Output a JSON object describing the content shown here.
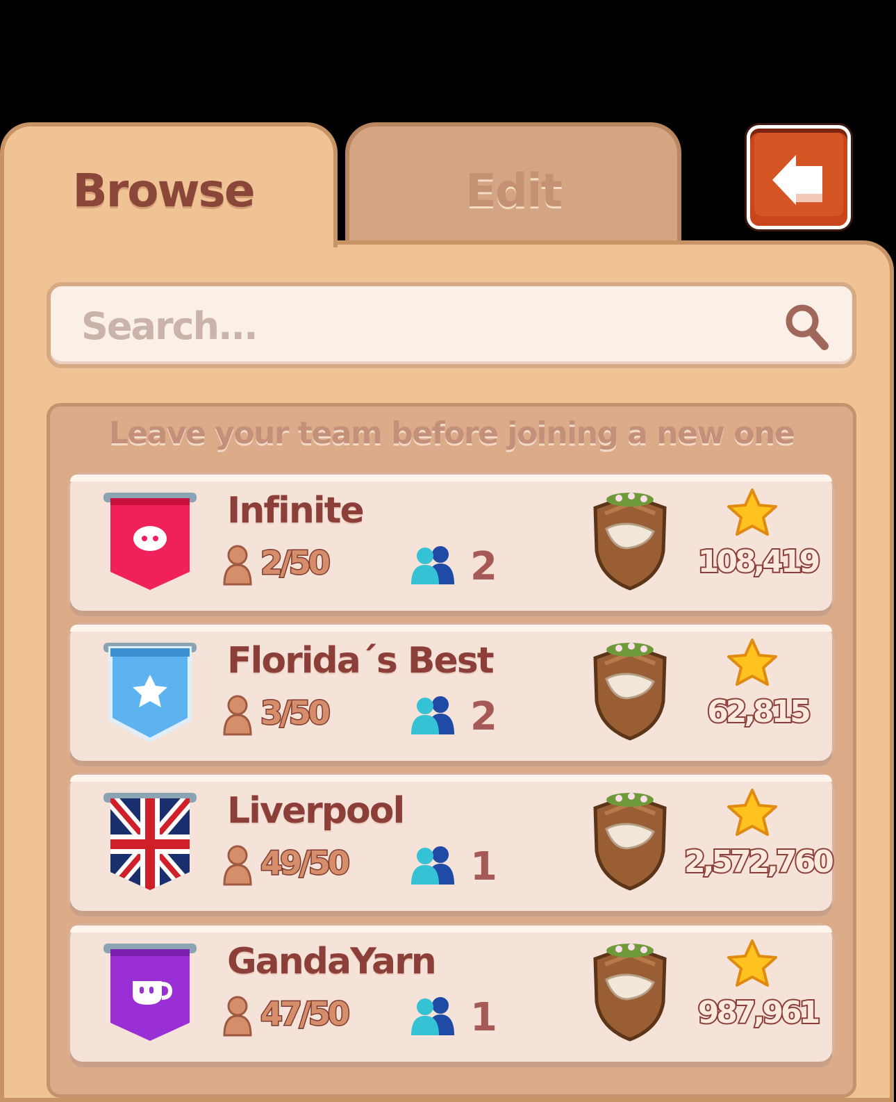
{
  "tabs": {
    "browse": "Browse",
    "edit": "Edit"
  },
  "back_button": {
    "icon": "back-arrow-icon"
  },
  "search": {
    "placeholder": "Search..."
  },
  "notice": "Leave your team before joining a new one",
  "teams": [
    {
      "name": "Infinite",
      "members": "2/50",
      "friends": "2",
      "score": "108,419",
      "banner_color": "#f0205a",
      "banner_icon": "pig-icon"
    },
    {
      "name": "Florida´s Best",
      "members": "3/50",
      "friends": "2",
      "score": "62,815",
      "banner_color": "#5cb3ef",
      "banner_icon": "star-icon"
    },
    {
      "name": "Liverpool",
      "members": "49/50",
      "friends": "1",
      "score": "2,572,760",
      "banner_color": "#1a2f6e",
      "banner_icon": "union-jack-icon"
    },
    {
      "name": "GandaYarn",
      "members": "47/50",
      "friends": "1",
      "score": "987,961",
      "banner_color": "#9b2fd6",
      "banner_icon": "cup-icon"
    }
  ]
}
